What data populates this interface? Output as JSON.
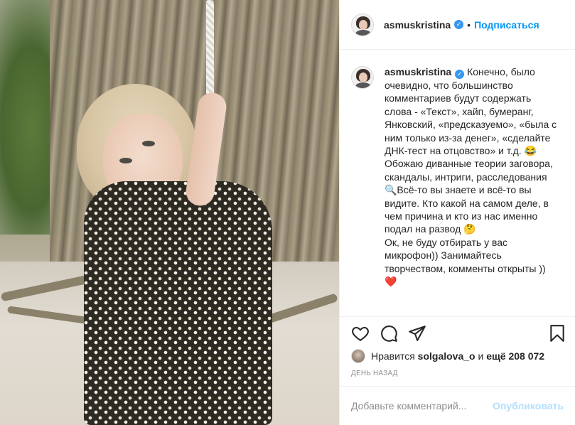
{
  "header": {
    "username": "asmuskristina",
    "verified_icon": "verified-badge-icon",
    "separator": "•",
    "follow_label": "Подписаться"
  },
  "caption": {
    "username": "asmuskristina",
    "text": "Конечно, было очевидно, что большинство комментариев будут содержать слова - «Текст», хайп, бумеранг, Янковский, «предсказуемо», «была с ним только из-за денег», «сделайте ДНК-тест на отцовство» и т.д. 😂\nОбожаю диванные теории заговора, скандалы, интриги, расследования 🔍Всё-то вы знаете и всё-то вы видите. Кто какой на самом деле, в чем причина и кто из нас именно подал на развод 🤔\nОк, не буду отбирать у вас микрофон)) Занимайтесь творчеством, комменты открыты ))\n❤️"
  },
  "actions": {
    "icons": [
      "heart-icon",
      "comment-icon",
      "share-icon",
      "bookmark-icon"
    ]
  },
  "likes": {
    "prefix": "Нравится",
    "user": "solgalova_o",
    "middle": "и",
    "count_text": "ещё 208 072"
  },
  "timestamp": "День назад",
  "comment": {
    "placeholder": "Добавьте комментарий...",
    "publish_label": "Опубликовать"
  },
  "colors": {
    "accent": "#0095f6",
    "publish_disabled": "#b2dffc",
    "muted": "#8e8e8e",
    "text": "#262626"
  }
}
